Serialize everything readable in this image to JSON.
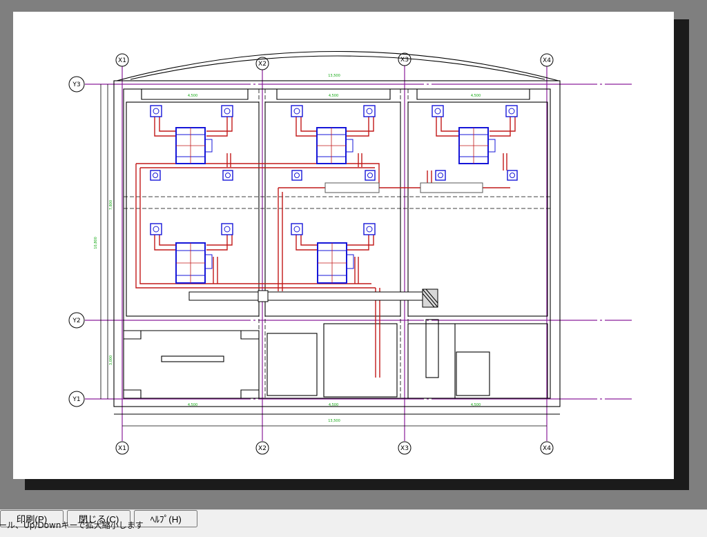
{
  "drawing": {
    "grid_labels": {
      "columns_top": [
        "X1",
        "X2",
        "X3",
        "X4"
      ],
      "columns_bottom": [
        "X1",
        "X2",
        "X3",
        "X4"
      ],
      "rows": [
        "Y3",
        "Y2",
        "Y1"
      ]
    },
    "dimensions": {
      "top_overall": "13,500",
      "top_spans": [
        "4,500",
        "4,500",
        "4,500"
      ],
      "bottom_spans": [
        "4,500",
        "4,500",
        "4,500"
      ],
      "bottom_overall": "13,500",
      "left_upper": "7,800",
      "left_overall": "10,800",
      "left_lower": "3,000"
    },
    "colors": {
      "gridline": "#8a1d9a",
      "walls": "#000000",
      "equipment": "#1515d8",
      "duct": "#c11818",
      "dimension": "#12a812"
    }
  },
  "statusbar": {
    "hint": "ール、Up/Downキーで拡大縮小します",
    "print_label": "印刷(P)",
    "close_label": "閉じる(C)",
    "help_label": "ﾍﾙﾌﾟ(H)"
  }
}
